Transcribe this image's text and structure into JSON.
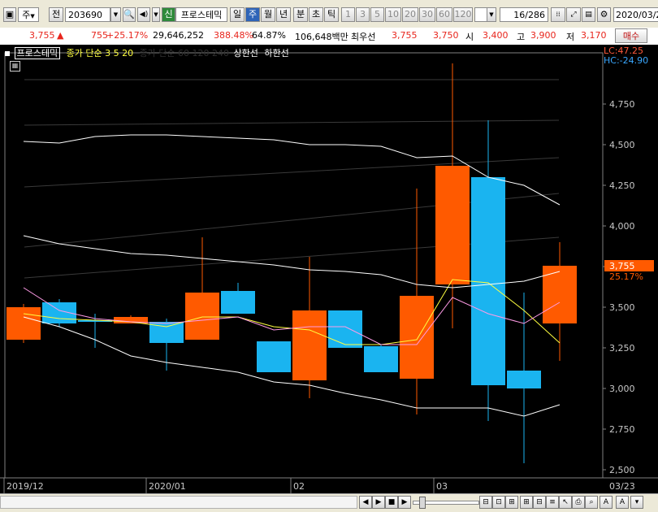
{
  "toolbar": {
    "period_label": "주",
    "prev_label": "전",
    "stock_code": "203690",
    "new_badge": "신",
    "stock_name": "프로스테믹",
    "periods": [
      "일",
      "주",
      "월",
      "년",
      "분",
      "초",
      "틱"
    ],
    "active_period": "주",
    "intervals": [
      "1",
      "3",
      "5",
      "10",
      "20",
      "30",
      "60",
      "120"
    ],
    "page_counter": "16",
    "page_total": "/286",
    "date": "2020/03/2"
  },
  "infobar": {
    "price": "3,755",
    "change_arrow": "▲",
    "change": "755",
    "change_pct": "+25.17%",
    "volume": "29,646,252",
    "volume_ratio": "388.48%",
    "turnover": "64.87%",
    "amount": "106,648백만",
    "best_ask_label": "최우선",
    "best_ask": "3,755",
    "best_bid": "3,750",
    "open_label": "시",
    "open": "3,400",
    "high_label": "고",
    "high": "3,900",
    "low_label": "저",
    "low": "3,170",
    "buy_label": "매수"
  },
  "legend": {
    "stock_name": "프로스테믹",
    "ma_label": "종가 단순 3 5 20",
    "hidden_label": "종가 단순 60 120 240",
    "upper_limit": "상한선",
    "lower_limit": "하한선",
    "lc_label": "LC:47.25",
    "hc_label": "HC:-24.90"
  },
  "chart_data": {
    "type": "candlestick",
    "x_labels": [
      "2019/12",
      "2020/01",
      "02",
      "03",
      "03/23"
    ],
    "y_ticks": [
      2500,
      2750,
      3000,
      3250,
      3500,
      3750,
      4000,
      4250,
      4500,
      4750
    ],
    "y_tick_labels": [
      "2,500",
      "2,750",
      "3,000",
      "3,250",
      "3,500",
      "3,750",
      "4,000",
      "4,250",
      "4,500",
      "4,750"
    ],
    "ylim": [
      2450,
      5000
    ],
    "current_price_label": "3,755",
    "current_change_label": "25.17%",
    "candles": [
      {
        "open": 3300,
        "close": 3500,
        "high": 3520,
        "low": 3280
      },
      {
        "open": 3530,
        "close": 3400,
        "high": 3550,
        "low": 3380
      },
      {
        "open": 3420,
        "close": 3410,
        "high": 3460,
        "low": 3250
      },
      {
        "open": 3400,
        "close": 3440,
        "high": 3450,
        "low": 3400
      },
      {
        "open": 3410,
        "close": 3280,
        "high": 3430,
        "low": 3110
      },
      {
        "open": 3300,
        "close": 3590,
        "high": 3930,
        "low": 3300
      },
      {
        "open": 3600,
        "close": 3460,
        "high": 3650,
        "low": 3460
      },
      {
        "open": 3290,
        "close": 3100,
        "high": 3290,
        "low": 3100
      },
      {
        "open": 3050,
        "close": 3480,
        "high": 3810,
        "low": 2940
      },
      {
        "open": 3480,
        "close": 3250,
        "high": 3480,
        "low": 3250
      },
      {
        "open": 3260,
        "close": 3100,
        "high": 3270,
        "low": 3100
      },
      {
        "open": 3060,
        "close": 3570,
        "high": 4230,
        "low": 2840
      },
      {
        "open": 3640,
        "close": 4370,
        "high": 5000,
        "low": 3370
      },
      {
        "open": 4300,
        "close": 3020,
        "high": 4650,
        "low": 2800
      },
      {
        "open": 3110,
        "close": 3000,
        "high": 3590,
        "low": 2540
      },
      {
        "open": 3400,
        "close": 3755,
        "high": 3900,
        "low": 3170
      }
    ],
    "series": [
      {
        "name": "3",
        "color": "#ffff40",
        "values": [
          3460,
          3430,
          3420,
          3410,
          3380,
          3440,
          3440,
          3380,
          3360,
          3270,
          3270,
          3300,
          3670,
          3650,
          3480,
          3280
        ]
      },
      {
        "name": "5",
        "color": "#ff9be6",
        "values": [
          3620,
          3480,
          3430,
          3410,
          3400,
          3420,
          3440,
          3360,
          3380,
          3380,
          3270,
          3270,
          3560,
          3460,
          3400,
          3530
        ]
      },
      {
        "name": "20",
        "color": "#ffffff",
        "values": [
          3940,
          3890,
          3860,
          3830,
          3820,
          3800,
          3780,
          3760,
          3730,
          3720,
          3700,
          3640,
          3620,
          3640,
          3660,
          3720
        ]
      },
      {
        "name": "상한선",
        "color": "#ffffff",
        "values": [
          4520,
          4510,
          4550,
          4560,
          4560,
          4550,
          4540,
          4530,
          4500,
          4500,
          4490,
          4420,
          4430,
          4300,
          4250,
          4130
        ]
      },
      {
        "name": "하한선",
        "color": "#ffffff",
        "values": [
          3440,
          3380,
          3300,
          3200,
          3160,
          3130,
          3100,
          3040,
          3020,
          2970,
          2930,
          2880,
          2880,
          2880,
          2830,
          2900
        ]
      }
    ],
    "grid": true,
    "up_color": "#ff5a00",
    "down_color": "#1ab4f0"
  }
}
